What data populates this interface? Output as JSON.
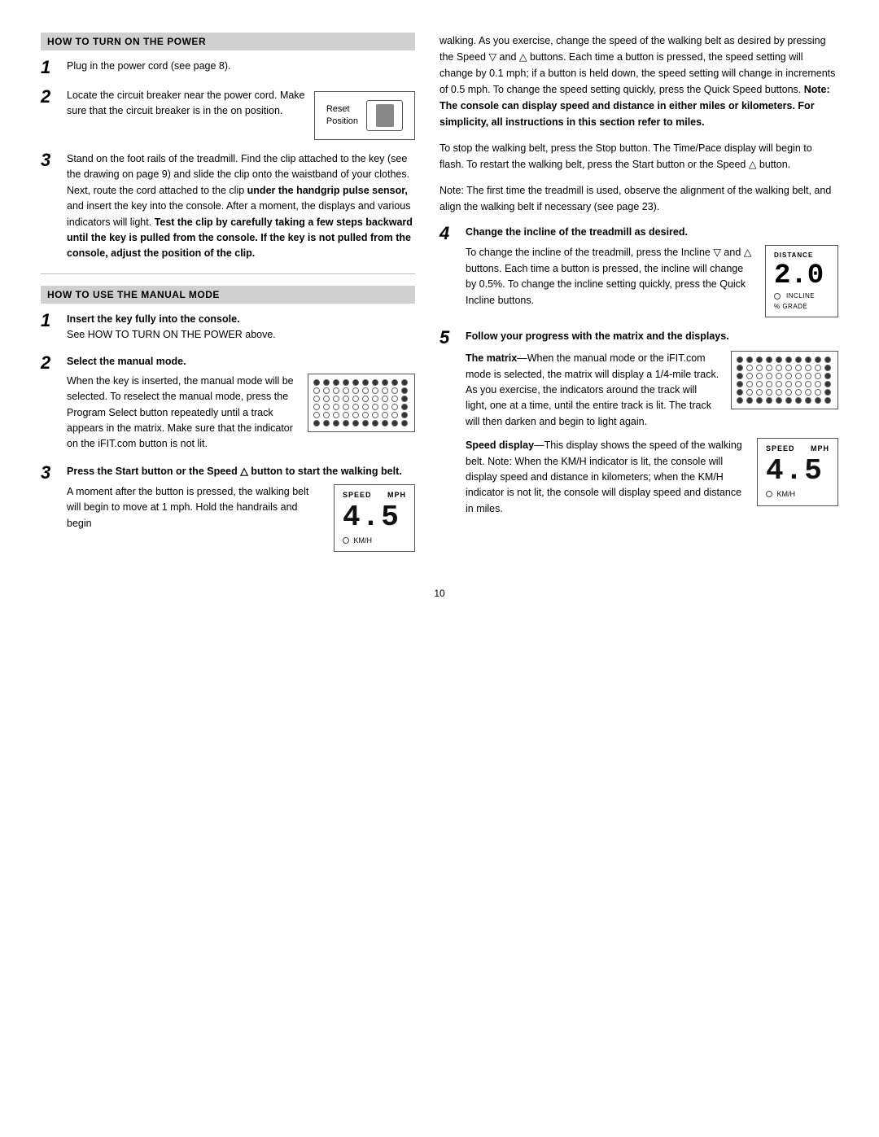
{
  "page": {
    "number": "10"
  },
  "left": {
    "section1_header": "HOW TO TURN ON THE POWER",
    "step1_text": "Plug in the power cord (see page 8).",
    "step2_intro": "Locate the circuit breaker near the power cord. Make sure that the circuit breaker is in the on position.",
    "step2_reset_label": "Reset\nPosition",
    "step3_text": "Stand on the foot rails of the treadmill. Find the clip attached to the key (see the drawing on page 9) and slide the clip onto the waistband of your clothes. Next, route the cord attached to the clip ",
    "step3_bold1": "under the handgrip pulse sensor,",
    "step3_text2": " and insert the key into the console. After a moment, the displays and various indicators will light. ",
    "step3_bold2": "Test the clip by carefully taking a few steps backward until the key is pulled from the console. If the key is not pulled from the console, adjust the position of the clip.",
    "section2_header": "HOW TO USE THE MANUAL MODE",
    "manual_step1_bold": "Insert the key fully into the console.",
    "manual_step1_text": "See HOW TO TURN ON THE POWER above.",
    "manual_step2_bold": "Select the manual mode.",
    "manual_step2_text": "When the key is inserted, the manual mode will be selected. To reselect the manual mode, press the Program Select button repeatedly until a track appears in the matrix. Make sure that the indicator on the iFIT.com button is not lit.",
    "manual_step3_bold": "Press the Start button or the Speed △ button to start the walking belt.",
    "manual_step3_text": "A moment after the button is pressed, the walking belt will begin to move at 1 mph. Hold the handrails and begin",
    "speed_label": "SPEED",
    "speed_unit": "MPH",
    "speed_value": "4.5",
    "kmh_label": "KM/H"
  },
  "right": {
    "text1": "walking. As you exercise, change the speed of the walking belt as desired by pressing the Speed ▽ and △ buttons. Each time a button is pressed, the speed setting will change by 0.1 mph; if a button is held down, the speed setting will change in increments of 0.5 mph. To change the speed setting quickly, press the Quick Speed buttons.",
    "text1_bold": "Note: The console can display speed and distance in either miles or kilometers. For simplicity, all instructions in this section refer to miles.",
    "text2": "To stop the walking belt, press the Stop button. The Time/Pace display will begin to flash. To restart the walking belt, press the Start button or the Speed △ button.",
    "text3": "Note: The first time the treadmill is used, observe the alignment of the walking belt, and align the walking belt if necessary (see page 23).",
    "step4_bold": "Change the incline of the treadmill as desired.",
    "step4_text": "To change the incline of the treadmill, press the Incline ▽ and △ buttons. Each time a button is pressed, the incline will change by 0.5%. To change the incline setting quickly, press the Quick Incline buttons.",
    "distance_label": "DISTANCE",
    "incline_value": "2.0",
    "incline_label": "INCLINE",
    "grade_label": "% GRADE",
    "step5_bold": "Follow your progress with the matrix and the displays.",
    "matrix_text_bold": "The matrix",
    "matrix_text": "—When the manual mode or the iFIT.com mode is selected, the matrix will display a 1/4-mile track. As you exercise, the indicators around the track will light, one at a time, until the entire track is lit. The track will then darken and begin to light again.",
    "speed_display_bold": "Speed display",
    "speed_display_text": "—This display shows the speed of the walking belt. Note: When the KM/H indicator is lit, the console will display speed and distance in kilometers; when the KM/H indicator is not lit, the console will display speed and distance in miles.",
    "speed_label2": "SPEED",
    "speed_unit2": "MPH",
    "speed_value2": "4.5",
    "kmh_label2": "KM/H"
  }
}
